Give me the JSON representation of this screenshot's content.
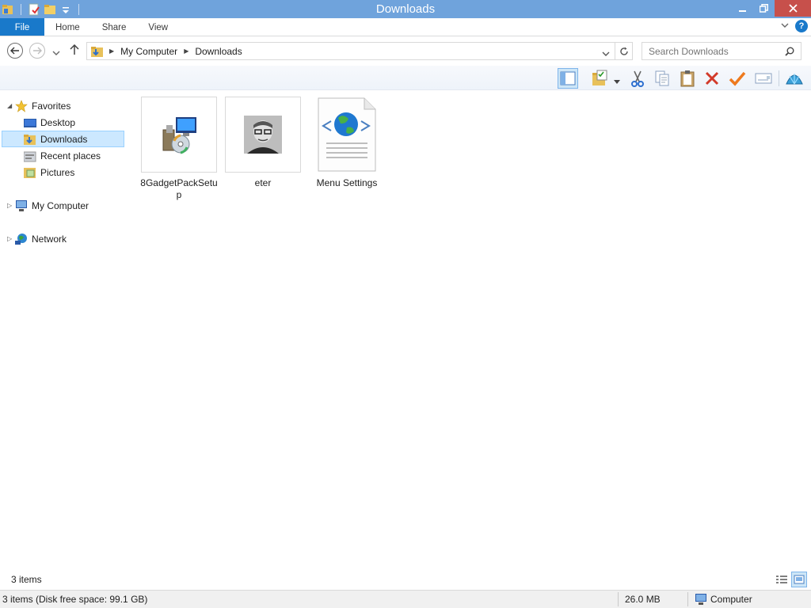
{
  "window": {
    "title": "Downloads"
  },
  "ribbon": {
    "tabs": [
      "File",
      "Home",
      "Share",
      "View"
    ],
    "help": "?"
  },
  "address": {
    "crumbs": [
      "My Computer",
      "Downloads"
    ]
  },
  "search": {
    "placeholder": "Search Downloads"
  },
  "nav": {
    "favorites": "Favorites",
    "items": [
      "Desktop",
      "Downloads",
      "Recent places",
      "Pictures"
    ],
    "my_computer": "My Computer",
    "network": "Network",
    "selected": "Downloads"
  },
  "files": [
    {
      "name": "8GadgetPackSetup",
      "icon": "installer-icon"
    },
    {
      "name": "eter",
      "icon": "photo-thumbnail"
    },
    {
      "name": "Menu Settings",
      "icon": "web-document-icon"
    }
  ],
  "status": {
    "item_count": "3 items",
    "disk": "3 items (Disk free space: 99.1 GB)",
    "size": "26.0 MB",
    "location": "Computer"
  },
  "colors": {
    "titlebar": "#6fa3dc",
    "file_tab": "#1979ca",
    "selection": "#cce8ff",
    "close": "#c7504b"
  }
}
